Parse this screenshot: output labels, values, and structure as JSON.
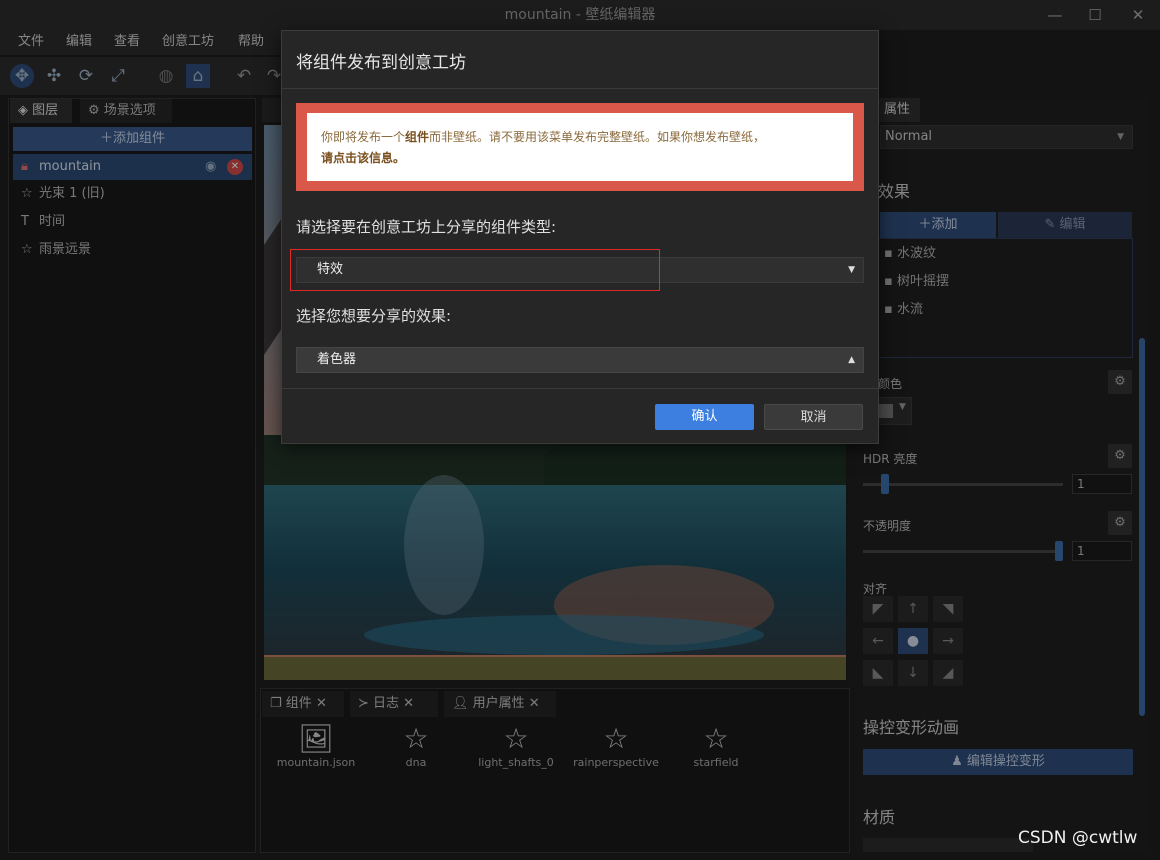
{
  "window": {
    "title": "mountain - 壁纸编辑器"
  },
  "menu": {
    "items": [
      "文件",
      "编辑",
      "查看",
      "创意工坊",
      "帮助"
    ]
  },
  "left_panel": {
    "tabs": [
      "图层",
      "场景选项"
    ],
    "add_component": "添加组件",
    "layers": [
      "mountain",
      "光束 1 (旧)",
      "时间",
      "雨景远景"
    ]
  },
  "bottom_panel": {
    "tabs": [
      "组件",
      "日志",
      "用户属性"
    ],
    "assets": [
      "mountain.json",
      "dna",
      "light_shafts_0",
      "rainperspective",
      "starfield"
    ]
  },
  "right_panel": {
    "tab": "属性",
    "blend_mode": "Normal",
    "effects_heading": "效果",
    "add_label": "添加",
    "edit_label": "编辑",
    "effects": [
      "水波纹",
      "树叶摇摆",
      "水流"
    ],
    "color_label": "调颜色",
    "hdr_label": "HDR 亮度",
    "hdr_value": "1",
    "opacity_label": "不透明度",
    "opacity_value": "1",
    "align_label": "对齐",
    "puppet_heading": "操控变形动画",
    "puppet_button": "编辑操控变形",
    "material_heading": "材质"
  },
  "dialog": {
    "title": "将组件发布到创意工坊",
    "warning_p1": "你即将发布一个",
    "warning_b1": "组件",
    "warning_p2": "而非壁纸。请不要用该菜单发布完整壁纸。如果你想发布壁纸，",
    "warning_b2": "请点击该信息。",
    "question1": "请选择要在创意工坊上分享的组件类型:",
    "select1": "特效",
    "question2": "选择您想要分享的效果:",
    "select2": "着色器",
    "ok": "确认",
    "cancel": "取消"
  },
  "watermark": "CSDN @cwtlw",
  "colors": {
    "accent": "#3d7fe0",
    "warning_border": "#d9584a",
    "highlight": "#e02a2a"
  }
}
